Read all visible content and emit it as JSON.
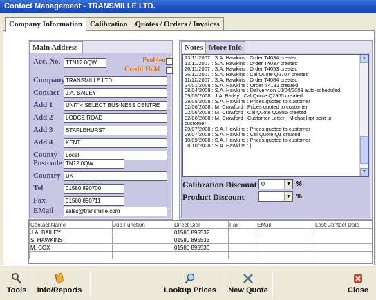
{
  "window": {
    "title": "Contact Management - TRANSMILLE LTD."
  },
  "tabs": [
    {
      "label": "Company Information",
      "active": true
    },
    {
      "label": "Calibration",
      "active": false
    },
    {
      "label": "Quotes / Orders / Invoices",
      "active": false
    }
  ],
  "address": {
    "tab_label": "Main Address",
    "acc_no_label": "Acc. No.",
    "acc_no": "TTN12 0QW",
    "problem_label": "Problem",
    "credit_hold_label": "Credit Hold",
    "company_label": "Company",
    "company": "TRANSMILLE LTD.",
    "contact_label": "Contact",
    "contact": "J.A. BAILEY",
    "add1_label": "Add 1",
    "add1": "UNIT 4 SELECT BUSINESS CENTRE",
    "add2_label": "Add 2",
    "add2": "LODGE ROAD",
    "add3_label": "Add 3",
    "add3": "STAPLEHURST",
    "add4_label": "Add 4",
    "add4": "KENT",
    "county_label": "County",
    "county": "Local",
    "postcode_label": "Postcode",
    "postcode": "TN12 0QW",
    "country_label": "Country",
    "country": "UK",
    "tel_label": "Tel",
    "tel": "01580 890700",
    "fax_label": "Fax",
    "fax": "01580 890711",
    "email_label": "EMail",
    "email": "sales@transmille.com"
  },
  "notes": {
    "tabs": [
      "Notes",
      "More Info"
    ],
    "lines": [
      "13/11/2007 : S.A. Hawkins : Order T4034 created",
      "13/11/2007 : S.A. Hawkins : Order T4037 created",
      "26/11/2007 : S.A. Hawkins : Order T4053 created",
      "26/11/2007 : S.A. Hawkins : Cal Quote Q2707 created",
      "11/12/2007 : S.A. Hawkins : Order T4084 created",
      "24/01/2008 : S.A. Hawkins : Order T4131 created",
      "08/04/2008 : S.A. Hawkins : Delivery on 10/04/2008 auto-scheduled.",
      "09/05/2008 : J.A. Bailey : Cal Quote Q2955 created",
      "28/05/2008 : S.A. Hawkins : Prices quoted to customer",
      "02/06/2008 : M. Crawford : Prices quoted to customer",
      "02/06/2008 : M. Crawford : Cal Quote Q2985 created",
      "02/06/2008 : M. Crawford : Customer Letter - Michael.rpt sent to",
      "customer",
      "29/07/2008 : S.A. Hawkins : Prices quoted to customer",
      "29/07/2008 : S.A. Hawkins : Cal Quote Q1 created",
      "10/09/2008 : S.A. Hawkins : Prices quoted to customer",
      "08/10/2008 : S.A. Hawkins : |"
    ],
    "calibration_discount_label": "Calibration Discount",
    "calibration_discount": "0",
    "product_discount_label": "Product Discount",
    "product_discount": "",
    "percent": "%"
  },
  "contacts": {
    "columns": [
      "Contact Name",
      "Job Function",
      "Direct Dial",
      "Fax",
      "EMail",
      "Last Contact Date"
    ],
    "rows": [
      [
        "J.A. BAILEY",
        "",
        "01580 895532",
        "",
        "",
        ""
      ],
      [
        "S. HAWKINS",
        "",
        "01580 895533",
        "",
        "",
        ""
      ],
      [
        "M. COX",
        "",
        "01580 895536",
        "",
        "",
        ""
      ],
      [
        "",
        "",
        "",
        "",
        "",
        ""
      ]
    ]
  },
  "toolbar": {
    "tools": "Tools",
    "info_reports": "Info/Reports",
    "lookup_prices": "Lookup Prices",
    "new_quote": "New Quote",
    "close": "Close"
  },
  "icons": {
    "tools": "wrench-icon",
    "info_reports": "book-icon",
    "lookup_prices": "magnifier-icon",
    "new_quote": "tools-crossed-icon",
    "close": "close-icon"
  },
  "colors": {
    "title_bar": "#1f54c4",
    "panel_bg": "#c9c7e4",
    "label_text": "#4a4776",
    "warning_label": "#d87a1a",
    "close_red": "#d33a2a"
  }
}
